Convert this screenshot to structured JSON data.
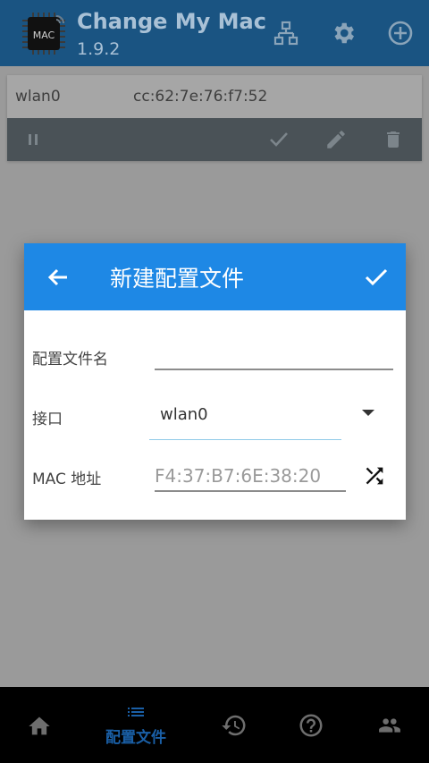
{
  "app": {
    "title": "Change My Mac",
    "version": "1.9.2",
    "logo_text": "MAC"
  },
  "toolbar": {
    "icons": [
      "network-icon",
      "gear-icon",
      "add-circle-icon"
    ]
  },
  "interface_card": {
    "name": "wlan0",
    "mac": "cc:62:7e:76:f7:52",
    "actions": [
      "pause-icon",
      "check-icon",
      "pencil-icon",
      "trash-icon"
    ]
  },
  "dialog": {
    "title": "新建配置文件",
    "profile_name_label": "配置文件名",
    "profile_name_value": "",
    "interface_label": "接口",
    "interface_value": "wlan0",
    "mac_label": "MAC 地址",
    "mac_placeholder": "F4:37:B7:6E:38:20"
  },
  "bottom_nav": {
    "active_label": "配置文件",
    "items": [
      "home-icon",
      "profiles-list-icon",
      "history-icon",
      "help-icon",
      "people-icon"
    ]
  },
  "colors": {
    "appbar": "#1a5482",
    "dialog_header": "#1e88e5",
    "nav_active": "#1a5fa6",
    "overlay": "#9a9a9a"
  }
}
